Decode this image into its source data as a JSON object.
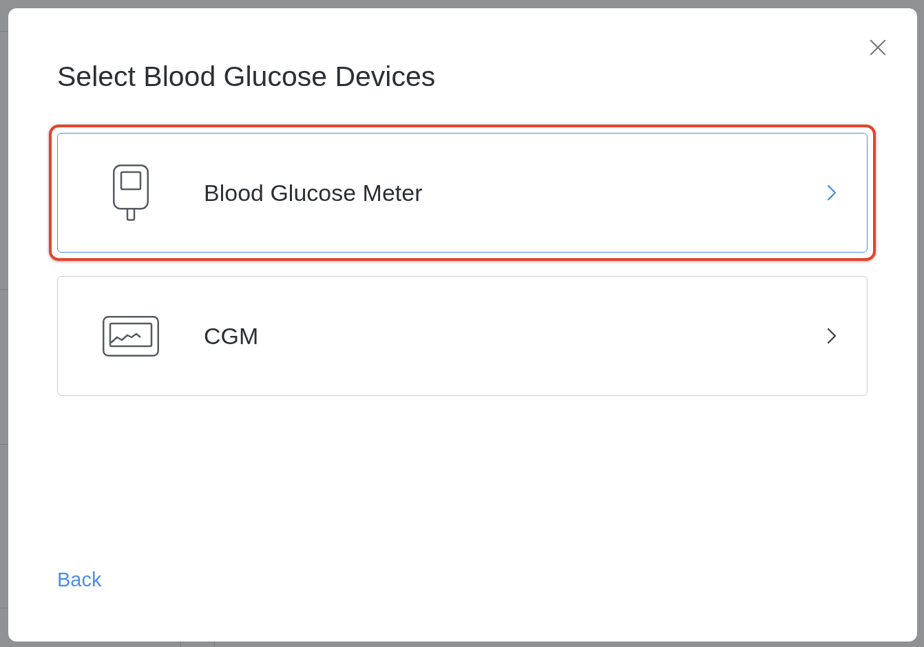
{
  "dialog": {
    "title": "Select Blood Glucose Devices"
  },
  "options": [
    {
      "kind": "meter",
      "label": "Blood Glucose Meter",
      "selected": true,
      "highlighted": true
    },
    {
      "kind": "cgm",
      "label": "CGM",
      "selected": false,
      "highlighted": false
    }
  ],
  "back_link": "Back"
}
